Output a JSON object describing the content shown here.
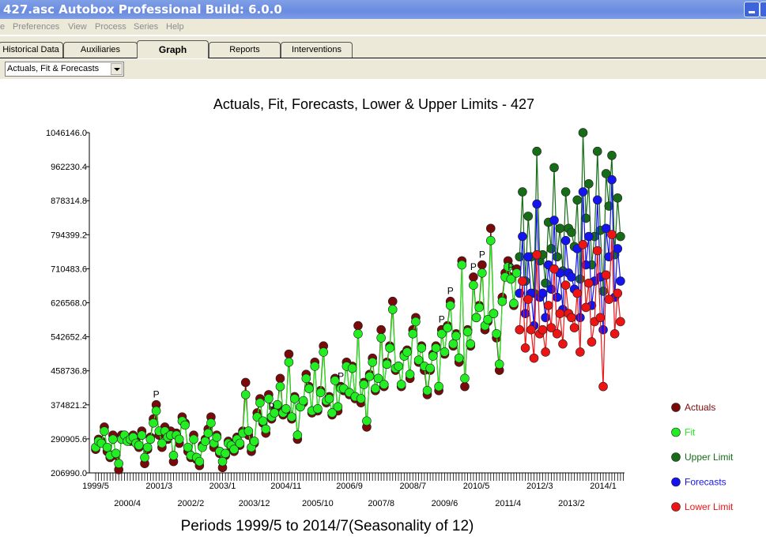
{
  "window": {
    "title": "427.asc  Autobox Professional Build: 6.0.0"
  },
  "menu": [
    "e",
    "Preferences",
    "View",
    "Process",
    "Series",
    "Help"
  ],
  "tabs": [
    {
      "label": "Historical Data"
    },
    {
      "label": "Auxiliaries"
    },
    {
      "label": "Graph",
      "active": true
    },
    {
      "label": "Reports"
    },
    {
      "label": "Interventions"
    }
  ],
  "graph_select": {
    "value": "Actuals, Fit & Forecasts"
  },
  "chart_data": {
    "type": "line",
    "title": "Actuals, Fit, Forecasts, Lower & Upper Limits - 427",
    "xlabel": "Periods 1999/5 to 2014/7(Seasonality of 12)",
    "ylabel": "",
    "ylim": [
      206990.0,
      1046146.0
    ],
    "yticks": [
      "1046146.0",
      "962230.4",
      "878314.8",
      "794399.2",
      "710483.6",
      "626568.0",
      "542652.4",
      "458736.8",
      "374821.2",
      "290905.6",
      "206990.0"
    ],
    "x_start": "1999/5",
    "xticks_row1": [
      "1999/5",
      "2001/3",
      "2003/1",
      "2004/11",
      "2006/9",
      "2008/7",
      "2010/5",
      "2012/3",
      "2014/1"
    ],
    "xticks_row2": [
      "2000/4",
      "2002/2",
      "2003/12",
      "2005/10",
      "2007/8",
      "2009/6",
      "2011/4",
      "2013/2"
    ],
    "legend_position": "right",
    "colors": {
      "actuals": "#7a0a0a",
      "fit": "#22ee22",
      "upper": "#176d17",
      "forecasts": "#1414ee",
      "lower": "#ee1414"
    },
    "series": [
      {
        "name": "Actuals",
        "start": "1999/5",
        "values": [
          265000,
          290000,
          285000,
          320000,
          260000,
          245000,
          300000,
          250000,
          215000,
          300000,
          295000,
          290000,
          285000,
          300000,
          285000,
          270000,
          310000,
          230000,
          265000,
          295000,
          340000,
          375000,
          300000,
          270000,
          320000,
          290000,
          310000,
          235000,
          305000,
          280000,
          345000,
          330000,
          260000,
          245000,
          300000,
          240000,
          225000,
          275000,
          290000,
          315000,
          345000,
          270000,
          300000,
          255000,
          220000,
          250000,
          285000,
          270000,
          260000,
          295000,
          275000,
          310000,
          430000,
          300000,
          260000,
          280000,
          355000,
          390000,
          330000,
          305000,
          400000,
          340000,
          360000,
          370000,
          440000,
          350000,
          360000,
          500000,
          340000,
          395000,
          290000,
          370000,
          380000,
          450000,
          420000,
          355000,
          480000,
          360000,
          410000,
          520000,
          380000,
          395000,
          350000,
          440000,
          360000,
          420000,
          410000,
          480000,
          400000,
          470000,
          390000,
          570000,
          380000,
          430000,
          320000,
          450000,
          490000,
          410000,
          440000,
          560000,
          420000,
          480000,
          520000,
          630000,
          460000,
          470000,
          420000,
          500000,
          510000,
          440000,
          560000,
          590000,
          480000,
          520000,
          460000,
          400000,
          460000,
          500000,
          520000,
          410000,
          560000,
          500000,
          570000,
          630000,
          520000,
          550000,
          480000,
          730000,
          420000,
          560000,
          520000,
          690000,
          590000,
          620000,
          720000,
          560000,
          580000,
          810000,
          600000,
          540000,
          460000,
          640000,
          700000,
          730000,
          690000,
          620000,
          710000
        ]
      },
      {
        "name": "Fit",
        "start": "1999/5",
        "values": [
          270000,
          285000,
          280000,
          310000,
          270000,
          250000,
          290000,
          255000,
          230000,
          290000,
          300000,
          285000,
          290000,
          295000,
          280000,
          275000,
          300000,
          245000,
          270000,
          290000,
          330000,
          360000,
          310000,
          280000,
          310000,
          295000,
          300000,
          250000,
          300000,
          290000,
          335000,
          325000,
          270000,
          250000,
          290000,
          245000,
          235000,
          270000,
          285000,
          305000,
          330000,
          280000,
          295000,
          260000,
          235000,
          255000,
          280000,
          275000,
          265000,
          290000,
          280000,
          305000,
          400000,
          310000,
          270000,
          285000,
          345000,
          380000,
          335000,
          315000,
          390000,
          345000,
          355000,
          375000,
          420000,
          355000,
          365000,
          480000,
          345000,
          390000,
          300000,
          370000,
          385000,
          440000,
          415000,
          360000,
          470000,
          365000,
          405000,
          505000,
          385000,
          390000,
          355000,
          435000,
          370000,
          415000,
          415000,
          470000,
          405000,
          465000,
          395000,
          550000,
          390000,
          425000,
          335000,
          445000,
          480000,
          415000,
          440000,
          540000,
          425000,
          475000,
          515000,
          610000,
          465000,
          470000,
          425000,
          495000,
          505000,
          450000,
          550000,
          580000,
          485000,
          515000,
          470000,
          410000,
          465000,
          495000,
          515000,
          420000,
          550000,
          505000,
          565000,
          620000,
          525000,
          545000,
          490000,
          720000,
          440000,
          555000,
          525000,
          670000,
          590000,
          615000,
          700000,
          570000,
          585000,
          780000,
          600000,
          550000,
          475000,
          630000,
          690000,
          715000,
          685000,
          625000,
          700000
        ]
      },
      {
        "name": "Upper Limit",
        "start": "2011/8",
        "values": [
          740000,
          900000,
          680000,
          840000,
          740000,
          650000,
          1000000,
          730000,
          745000,
          675000,
          825000,
          760000,
          960000,
          740000,
          810000,
          705000,
          900000,
          810000,
          800000,
          765000,
          880000,
          685000,
          1046000,
          835000,
          920000,
          720000,
          790000,
          1000000,
          805000,
          655000,
          945000,
          865000,
          990000,
          745000,
          885000,
          790000
        ]
      },
      {
        "name": "Forecasts",
        "start": "2011/8",
        "values": [
          650000,
          790000,
          600000,
          740000,
          650000,
          570000,
          870000,
          640000,
          650000,
          590000,
          720000,
          660000,
          830000,
          640000,
          700000,
          610000,
          780000,
          700000,
          690000,
          660000,
          760000,
          590000,
          900000,
          720000,
          790000,
          620000,
          680000,
          880000,
          690000,
          560000,
          810000,
          740000,
          930000,
          640000,
          760000,
          680000
        ]
      },
      {
        "name": "Lower Limit",
        "start": "2011/8",
        "values": [
          560000,
          680000,
          515000,
          635000,
          560000,
          490000,
          745000,
          550000,
          560000,
          505000,
          620000,
          565000,
          710000,
          550000,
          600000,
          525000,
          670000,
          600000,
          590000,
          565000,
          650000,
          505000,
          770000,
          615000,
          675000,
          530000,
          580000,
          755000,
          590000,
          420000,
          695000,
          635000,
          795000,
          550000,
          650000,
          580000
        ]
      }
    ],
    "annotations": [
      {
        "period": "2001/2",
        "text": "P"
      },
      {
        "period": "2004/6",
        "text": "P"
      },
      {
        "period": "2006/6",
        "text": "P"
      },
      {
        "period": "2009/5",
        "text": "P"
      },
      {
        "period": "2009/8",
        "text": "P"
      },
      {
        "period": "2010/4",
        "text": "P"
      },
      {
        "period": "2010/7",
        "text": "P"
      },
      {
        "period": "2011/5",
        "text": "P"
      }
    ]
  }
}
